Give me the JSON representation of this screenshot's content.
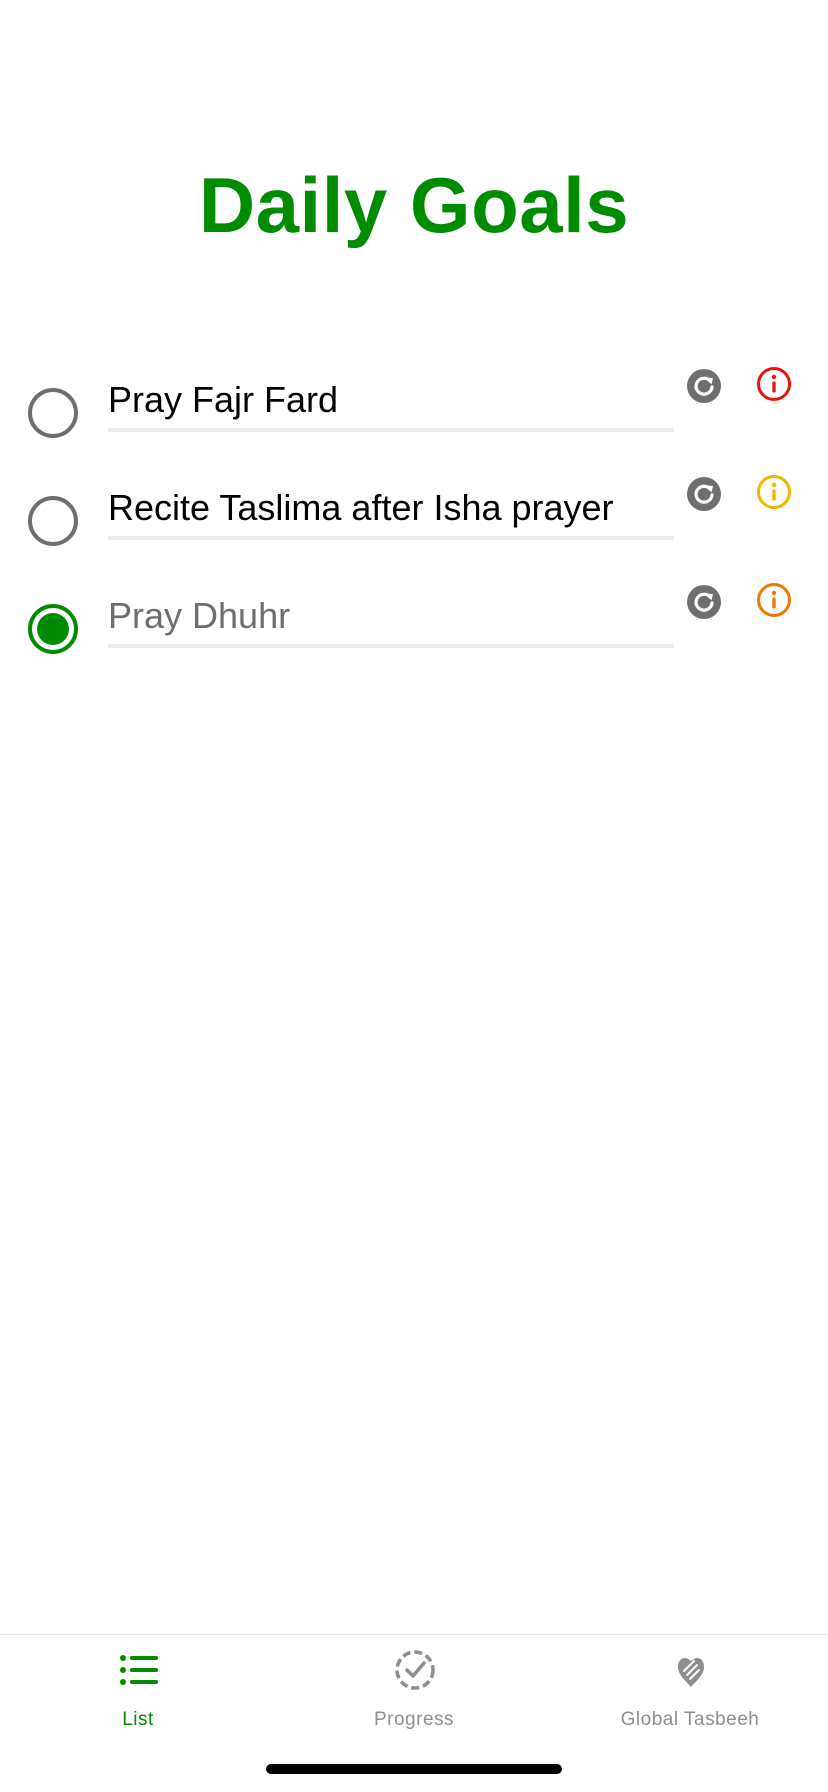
{
  "header": {
    "title": "Daily Goals"
  },
  "goals": [
    {
      "text": "Pray Fajr Fard",
      "completed": false,
      "info_color": "#e8120c",
      "reset_icon": "refresh-icon",
      "info_icon": "info-icon"
    },
    {
      "text": "Recite Taslima after Isha prayer",
      "completed": false,
      "info_color": "#f4b400",
      "reset_icon": "refresh-icon",
      "info_icon": "info-icon"
    },
    {
      "text": "Pray Dhuhr",
      "completed": true,
      "info_color": "#f07800",
      "reset_icon": "refresh-icon",
      "info_icon": "info-icon"
    }
  ],
  "tab_bar": {
    "tabs": [
      {
        "label": "List",
        "icon": "list-icon",
        "active": true
      },
      {
        "label": "Progress",
        "icon": "progress-check-icon",
        "active": false
      },
      {
        "label": "Global Tasbeeh",
        "icon": "praying-hands-icon",
        "active": false
      }
    ]
  },
  "colors": {
    "accent": "#008c00",
    "inactive": "#8e8e8e",
    "icon_gray": "#6e6e6e"
  }
}
